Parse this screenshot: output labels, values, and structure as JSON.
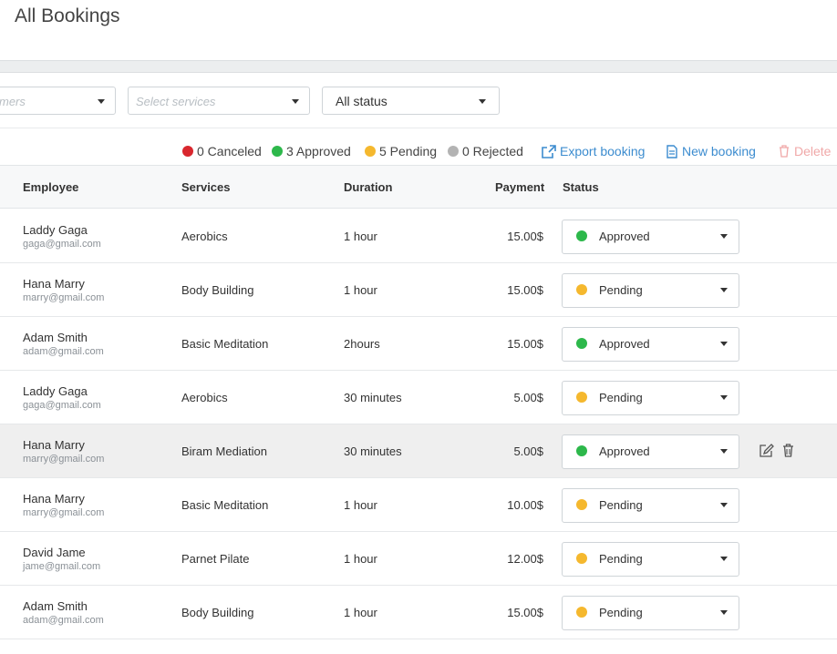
{
  "page": {
    "title": "All Bookings"
  },
  "filters": {
    "customers_placeholder": "Select customers",
    "customers_visible": "mers",
    "services_placeholder": "Select services",
    "status_value": "All status"
  },
  "summary": {
    "canceled": "0 Canceled",
    "approved": "3 Approved",
    "pending": "5 Pending",
    "rejected": "0 Rejected"
  },
  "actions": {
    "export": "Export booking",
    "new": "New booking",
    "delete": "Delete"
  },
  "colors": {
    "canceled": "#d9272e",
    "approved": "#2db84b",
    "pending": "#f5b82e",
    "rejected": "#b3b3b3",
    "link": "#3c8ccf"
  },
  "table": {
    "headers": {
      "employee": "Employee",
      "services": "Services",
      "duration": "Duration",
      "payment": "Payment",
      "status": "Status"
    },
    "rows": [
      {
        "name": "Laddy Gaga",
        "email": "gaga@gmail.com",
        "service": "Aerobics",
        "duration": "1 hour",
        "payment": "15.00$",
        "status": "Approved"
      },
      {
        "name": "Hana Marry",
        "email": "marry@gmail.com",
        "service": "Body Building",
        "duration": "1 hour",
        "payment": "15.00$",
        "status": "Pending"
      },
      {
        "name": "Adam Smith",
        "email": "adam@gmail.com",
        "service": "Basic Meditation",
        "duration": "2hours",
        "payment": "15.00$",
        "status": "Approved"
      },
      {
        "name": "Laddy Gaga",
        "email": "gaga@gmail.com",
        "service": "Aerobics",
        "duration": "30 minutes",
        "payment": "5.00$",
        "status": "Pending"
      },
      {
        "name": "Hana Marry",
        "email": "marry@gmail.com",
        "service": "Biram Mediation",
        "duration": "30 minutes",
        "payment": "5.00$",
        "status": "Approved"
      },
      {
        "name": "Hana Marry",
        "email": "marry@gmail.com",
        "service": "Basic Meditation",
        "duration": "1 hour",
        "payment": "10.00$",
        "status": "Pending"
      },
      {
        "name": "David Jame",
        "email": "jame@gmail.com",
        "service": "Parnet Pilate",
        "duration": "1 hour",
        "payment": "12.00$",
        "status": "Pending"
      },
      {
        "name": "Adam Smith",
        "email": "adam@gmail.com",
        "service": "Body Building",
        "duration": "1 hour",
        "payment": "15.00$",
        "status": "Pending"
      }
    ]
  }
}
